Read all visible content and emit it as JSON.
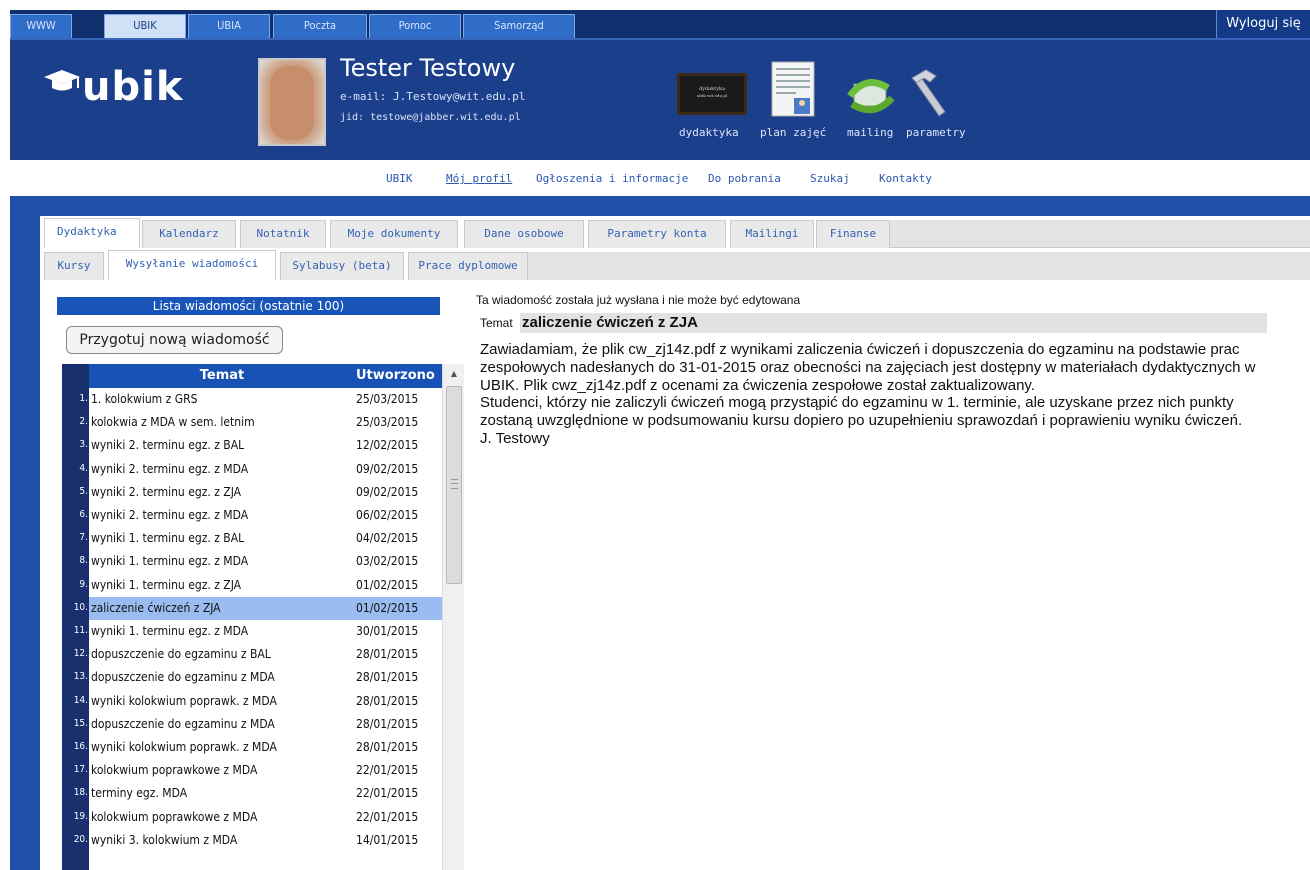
{
  "top_tabs": [
    "WWW",
    "UBIK",
    "UBIA",
    "Poczta",
    "Pomoc",
    "Samorząd"
  ],
  "logout": "Wyloguj się",
  "header": {
    "logo": "ubik",
    "user_name": "Tester Testowy",
    "email": "e-mail: J.Testowy@wit.edu.pl",
    "jid": "jid: testowe@jabber.wit.edu.pl",
    "icons": [
      {
        "label": "dydaktyka",
        "icon": "blackboard-icon"
      },
      {
        "label": "plan zajęć",
        "icon": "schedule-document-icon"
      },
      {
        "label": "mailing",
        "icon": "mailing-icon"
      },
      {
        "label": "parametry",
        "icon": "hammer-icon"
      }
    ]
  },
  "nav_links": [
    "UBIK",
    "Mój profil",
    "Ogłoszenia i informacje",
    "Do pobrania",
    "Szukaj",
    "Kontakty"
  ],
  "tabs_primary": [
    "Dydaktyka",
    "Kalendarz",
    "Notatnik",
    "Moje dokumenty",
    "Dane osobowe",
    "Parametry konta",
    "Mailingi",
    "Finanse"
  ],
  "tabs_secondary": [
    "Kursy",
    "Wysyłanie wiadomości",
    "Sylabusy (beta)",
    "Prace dyplomowe"
  ],
  "message_list": {
    "title": "Lista wiadomości (ostatnie 100)",
    "new_button": "Przygotuj nową wiadomość",
    "col_topic": "Temat",
    "col_date": "Utworzono",
    "rows": [
      {
        "n": "1.",
        "topic": "1. kolokwium z GRS",
        "date": "25/03/2015"
      },
      {
        "n": "2.",
        "topic": "kolokwia z MDA w sem. letnim",
        "date": "25/03/2015"
      },
      {
        "n": "3.",
        "topic": "wyniki 2. terminu egz. z BAL",
        "date": "12/02/2015"
      },
      {
        "n": "4.",
        "topic": "wyniki 2. terminu egz. z MDA",
        "date": "09/02/2015"
      },
      {
        "n": "5.",
        "topic": "wyniki 2. terminu egz. z ZJA",
        "date": "09/02/2015"
      },
      {
        "n": "6.",
        "topic": "wyniki 2. terminu egz. z MDA",
        "date": "06/02/2015"
      },
      {
        "n": "7.",
        "topic": "wyniki 1. terminu egz. z BAL",
        "date": "04/02/2015"
      },
      {
        "n": "8.",
        "topic": "wyniki 1. terminu egz. z MDA",
        "date": "03/02/2015"
      },
      {
        "n": "9.",
        "topic": "wyniki 1. terminu egz. z ZJA",
        "date": "01/02/2015"
      },
      {
        "n": "10.",
        "topic": "zaliczenie ćwiczeń z ZJA",
        "date": "01/02/2015",
        "selected": true
      },
      {
        "n": "11.",
        "topic": "wyniki 1. terminu egz. z MDA",
        "date": "30/01/2015"
      },
      {
        "n": "12.",
        "topic": "dopuszczenie do egzaminu z BAL",
        "date": "28/01/2015"
      },
      {
        "n": "13.",
        "topic": "dopuszczenie do egzaminu z MDA",
        "date": "28/01/2015"
      },
      {
        "n": "14.",
        "topic": "wyniki kolokwium poprawk. z MDA",
        "date": "28/01/2015"
      },
      {
        "n": "15.",
        "topic": "dopuszczenie do egzaminu z MDA",
        "date": "28/01/2015"
      },
      {
        "n": "16.",
        "topic": "wyniki kolokwium poprawk. z MDA",
        "date": "28/01/2015"
      },
      {
        "n": "17.",
        "topic": "kolokwium poprawkowe z MDA",
        "date": "22/01/2015"
      },
      {
        "n": "18.",
        "topic": "terminy egz. MDA",
        "date": "22/01/2015"
      },
      {
        "n": "19.",
        "topic": "kolokwium poprawkowe z MDA",
        "date": "22/01/2015"
      },
      {
        "n": "20.",
        "topic": "wyniki 3. kolokwium z MDA",
        "date": "14/01/2015"
      }
    ]
  },
  "message": {
    "info": "Ta wiadomość została już wysłana i nie może być edytowana",
    "topic_label": "Temat",
    "topic": "zaliczenie ćwiczeń z ZJA",
    "body": [
      "Zawiadamiam, że plik cw_zj14z.pdf z wynikami zaliczenia ćwiczeń i dopuszczenia do egzaminu na podstawie prac zespołowych nadesłanych do 31-01-2015 oraz obecności na zajęciach jest dostępny w materiałach dydaktycznych w UBIK. Plik cwz_zj14z.pdf z ocenami za ćwiczenia zespołowe został zaktualizowany.",
      "Studenci, którzy nie zaliczyli ćwiczeń mogą przystąpić do egzaminu w 1. terminie, ale uzyskane przez nich punkty zostaną uwzględnione w podsumowaniu kursu dopiero po uzupełnieniu sprawozdań i poprawieniu wyniku ćwiczeń.",
      "J. Testowy"
    ]
  },
  "colors": {
    "header_bg": "#1c3f8c",
    "top_bar": "#0f2f6e",
    "selected_row": "#9bbcf0",
    "accent": "#1954b8"
  }
}
